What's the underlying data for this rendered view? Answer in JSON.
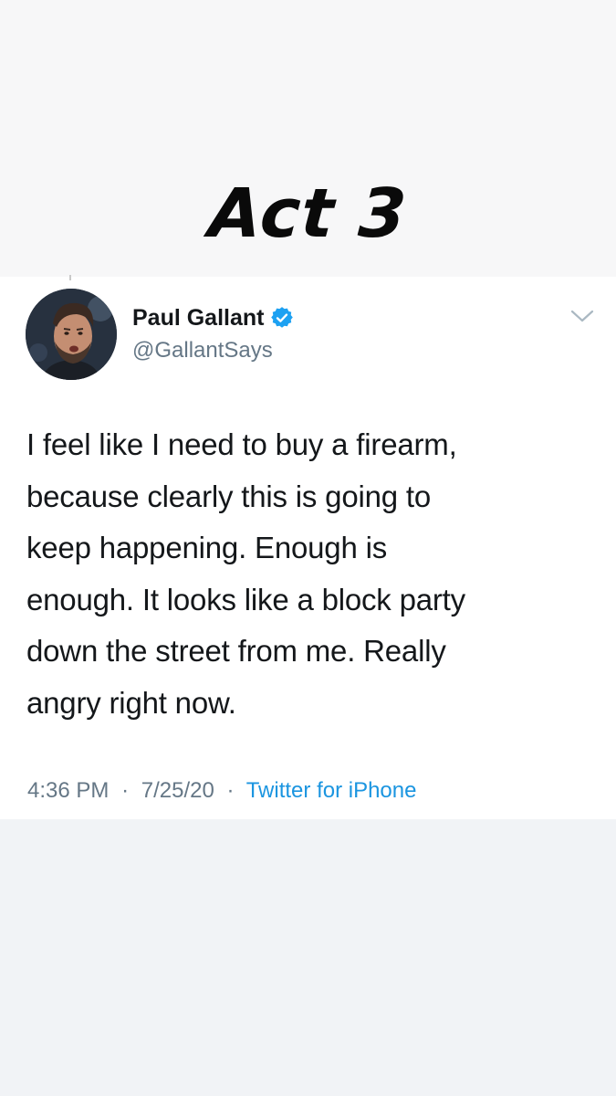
{
  "story": {
    "headline": "Act 3"
  },
  "tweet": {
    "author": {
      "display_name": "Paul Gallant",
      "handle": "@GallantSays",
      "verified": true,
      "avatar_icon": "profile-photo"
    },
    "text_lines": [
      "I feel like I need to buy a firearm,",
      "because clearly this is going to",
      "keep happening. Enough is",
      "enough. It looks like a block party",
      "down the street from me. Really",
      "angry right now."
    ],
    "time": "4:36 PM",
    "date": "7/25/20",
    "separator": "·",
    "source": "Twitter for iPhone",
    "menu_icon": "chevron-down-icon"
  },
  "colors": {
    "text_primary": "#14171a",
    "text_secondary": "#657786",
    "link": "#1b95e0",
    "verified_badge": "#1da1f2",
    "card_background": "#ffffff",
    "page_background": "#f1f3f6"
  }
}
